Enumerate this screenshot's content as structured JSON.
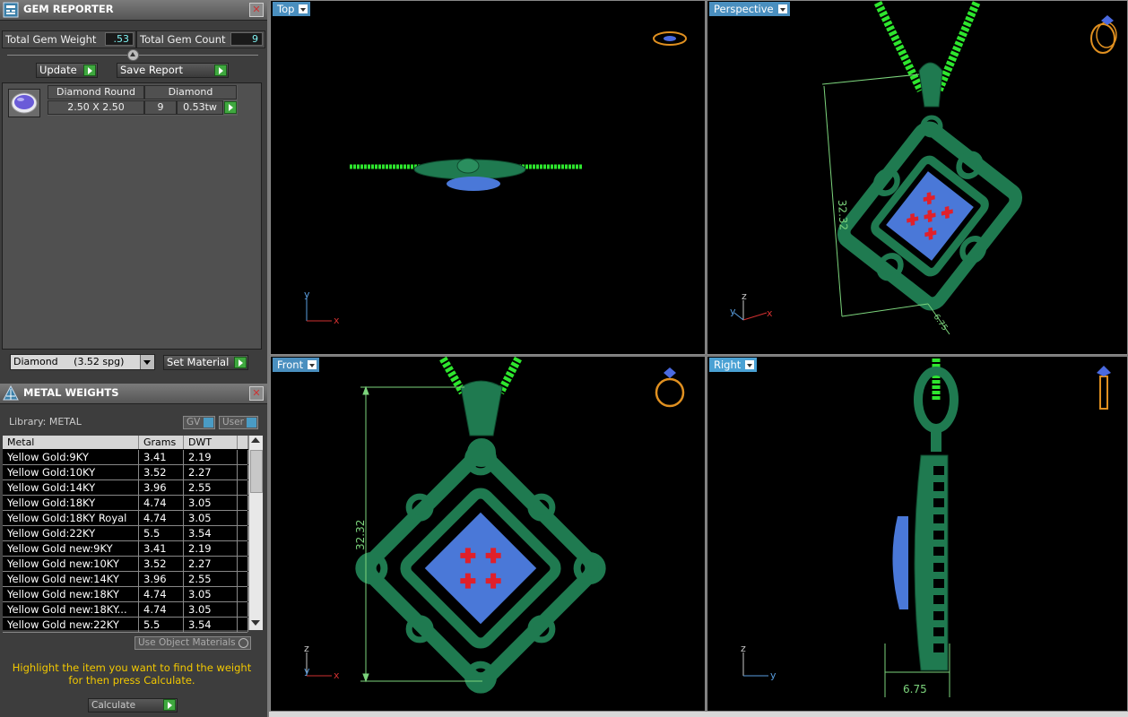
{
  "gem_reporter": {
    "title": "GEM REPORTER",
    "total_weight_label": "Total Gem Weight",
    "total_weight_value": ".53",
    "total_count_label": "Total Gem Count",
    "total_count_value": "9",
    "update_label": "Update",
    "save_report_label": "Save Report",
    "gem_table": {
      "col1_header": "Diamond Round",
      "col2_header": "Diamond",
      "size": "2.50 X 2.50",
      "count": "9",
      "weight": "0.53tw"
    },
    "material_dropdown": "Diamond     (3.52 spg)",
    "set_material_label": "Set Material"
  },
  "metal_weights": {
    "title": "METAL WEIGHTS",
    "library_label": "Library: METAL",
    "gv_label": "GV",
    "user_label": "User",
    "columns": [
      "Metal",
      "Grams",
      "DWT"
    ],
    "rows": [
      [
        "Yellow Gold:9KY",
        "3.41",
        "2.19"
      ],
      [
        "Yellow Gold:10KY",
        "3.52",
        "2.27"
      ],
      [
        "Yellow Gold:14KY",
        "3.96",
        "2.55"
      ],
      [
        "Yellow Gold:18KY",
        "4.74",
        "3.05"
      ],
      [
        "Yellow Gold:18KY Royal",
        "4.74",
        "3.05"
      ],
      [
        "Yellow Gold:22KY",
        "5.5",
        "3.54"
      ],
      [
        "Yellow Gold new:9KY",
        "3.41",
        "2.19"
      ],
      [
        "Yellow Gold new:10KY",
        "3.52",
        "2.27"
      ],
      [
        "Yellow Gold new:14KY",
        "3.96",
        "2.55"
      ],
      [
        "Yellow Gold new:18KY",
        "4.74",
        "3.05"
      ],
      [
        "Yellow Gold new:18KY...",
        "4.74",
        "3.05"
      ],
      [
        "Yellow Gold new:22KY",
        "5.5",
        "3.54"
      ]
    ],
    "use_object_materials_label": "Use Object Materials",
    "hint_line1": "Highlight the item you want to find the weight",
    "hint_line2": "for then press Calculate.",
    "calculate_label": "Calculate"
  },
  "viewports": {
    "top": {
      "label": "Top",
      "axis_a": "y",
      "axis_b": "x"
    },
    "perspective": {
      "label": "Perspective",
      "axis_a": "z",
      "axis_b": "y",
      "axis_c": "x",
      "dim_height": "32.32",
      "dim_width": "6.75"
    },
    "front": {
      "label": "Front",
      "axis_a": "z",
      "axis_b": "y",
      "axis_c": "x",
      "dim_height": "32.32"
    },
    "right": {
      "label": "Right",
      "axis_a": "z",
      "axis_b": "y",
      "dim_width": "6.75"
    }
  },
  "colors": {
    "metal": "#1f7a50",
    "chain": "#2ee62e",
    "gem_blue": "#4a78d8",
    "prong_red": "#e0202a",
    "dimension": "#7cd47c",
    "tab": "#4aa1d4",
    "hint_text": "#f2c800"
  }
}
